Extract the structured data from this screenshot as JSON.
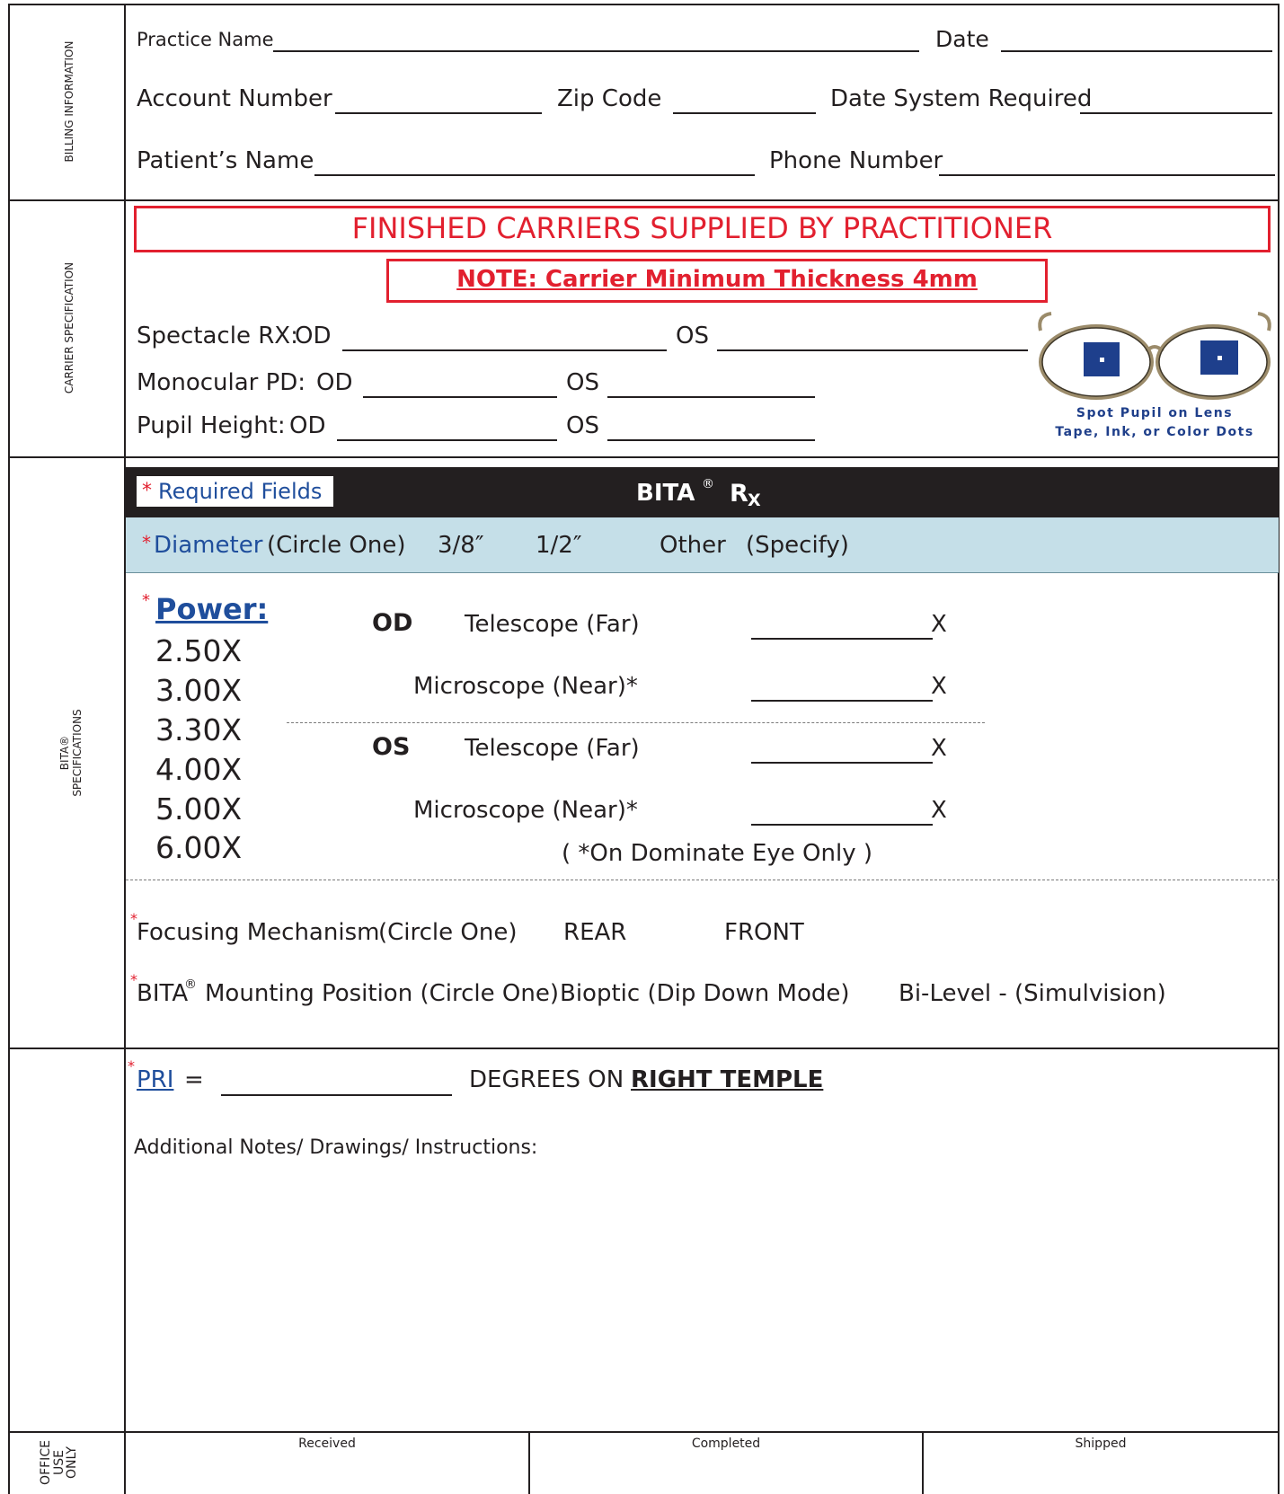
{
  "sections": {
    "billing": "BILLING INFORMATION",
    "carrier": "CARRIER SPECIFICATION",
    "bita_line1": "BITA®",
    "bita_line2": "SPECIFICATIONS",
    "office_line1": "OFFICE",
    "office_line2": "USE",
    "office_line3": "ONLY"
  },
  "billing": {
    "practice_name": "Practice Name",
    "date": "Date",
    "account_number": "Account Number",
    "zip_code": "Zip Code",
    "date_system_required": "Date System Required",
    "patients_name": "Patient’s Name",
    "phone_number": "Phone Number"
  },
  "carrier": {
    "banner": "FINISHED CARRIERS SUPPLIED BY PRACTITIONER",
    "note": "NOTE: Carrier Minimum Thickness 4mm",
    "spectacle_rx": "Spectacle RX:",
    "monocular_pd": "Monocular PD:",
    "pupil_height": "Pupil Height:",
    "od": "OD",
    "os": "OS",
    "spot_line1": "Spot Pupil on Lens",
    "spot_line2": "Tape, Ink, or Color Dots"
  },
  "bita": {
    "required_star": "*",
    "required_fields": "Required Fields",
    "title": "BITA",
    "title_reg": "®",
    "rx_r": "R",
    "rx_x": "X",
    "diameter_star": "*",
    "diameter": "Diameter",
    "circle_one": "(Circle One)",
    "opt_38": "3/8″",
    "opt_12": "1/2″",
    "other": "Other",
    "specify": "(Specify)",
    "power_star": "*",
    "power_label": "Power:",
    "powers": [
      "2.50X",
      "3.00X",
      "3.30X",
      "4.00X",
      "5.00X",
      "6.00X"
    ],
    "od": "OD",
    "os": "OS",
    "telescope": "Telescope (Far)",
    "microscope": "Microscope (Near)*",
    "x": "X",
    "dominate_note": "( *On Dominate Eye Only )",
    "focusing_star": "*",
    "focusing": "Focusing Mechanism",
    "focusing_circle": "(Circle One)",
    "rear": "REAR",
    "front": "FRONT",
    "mounting_star": "*",
    "mounting_bita": "BITA",
    "mounting_reg": "®",
    "mounting": "Mounting Position (Circle One)",
    "bioptic": "Bioptic (Dip Down Mode)",
    "bilevel": "Bi-Level - (Simulvision)"
  },
  "pri": {
    "star": "*",
    "label": "PRI",
    "equals": "=",
    "degrees_on": "DEGREES ON",
    "right_temple": "RIGHT TEMPLE",
    "notes": "Additional Notes/ Drawings/ Instructions:"
  },
  "office": {
    "received": "Received",
    "completed": "Completed",
    "shipped": "Shipped"
  },
  "colors": {
    "red": "#e2202f",
    "blue": "#1f4e9c",
    "band": "#c5dfe8",
    "lens_dot": "#1e3f8c"
  }
}
